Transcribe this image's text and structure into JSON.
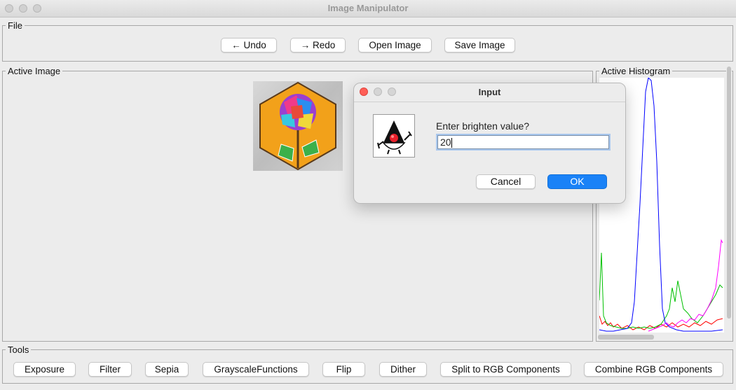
{
  "window": {
    "title": "Image Manipulator"
  },
  "file_panel": {
    "legend": "File",
    "buttons": [
      "← Undo",
      "→ Redo",
      "Open Image",
      "Save Image"
    ]
  },
  "active_image": {
    "legend": "Active Image"
  },
  "histogram": {
    "legend": "Active Histogram",
    "colors": [
      "#ff0000",
      "#00c000",
      "#0000ff",
      "#ff00ff"
    ]
  },
  "tools_panel": {
    "legend": "Tools",
    "buttons": [
      "Exposure",
      "Filter",
      "Sepia",
      "GrayscaleFunctions",
      "Flip",
      "Dither",
      "Split to RGB Components",
      "Combine RGB Components"
    ]
  },
  "dialog": {
    "title": "Input",
    "prompt": "Enter brighten value?",
    "input_value": "20",
    "cancel_label": "Cancel",
    "ok_label": "OK",
    "icon": "java-duke-icon"
  },
  "colors": {
    "accent": "#1a82f7",
    "close": "#ff5f57"
  }
}
